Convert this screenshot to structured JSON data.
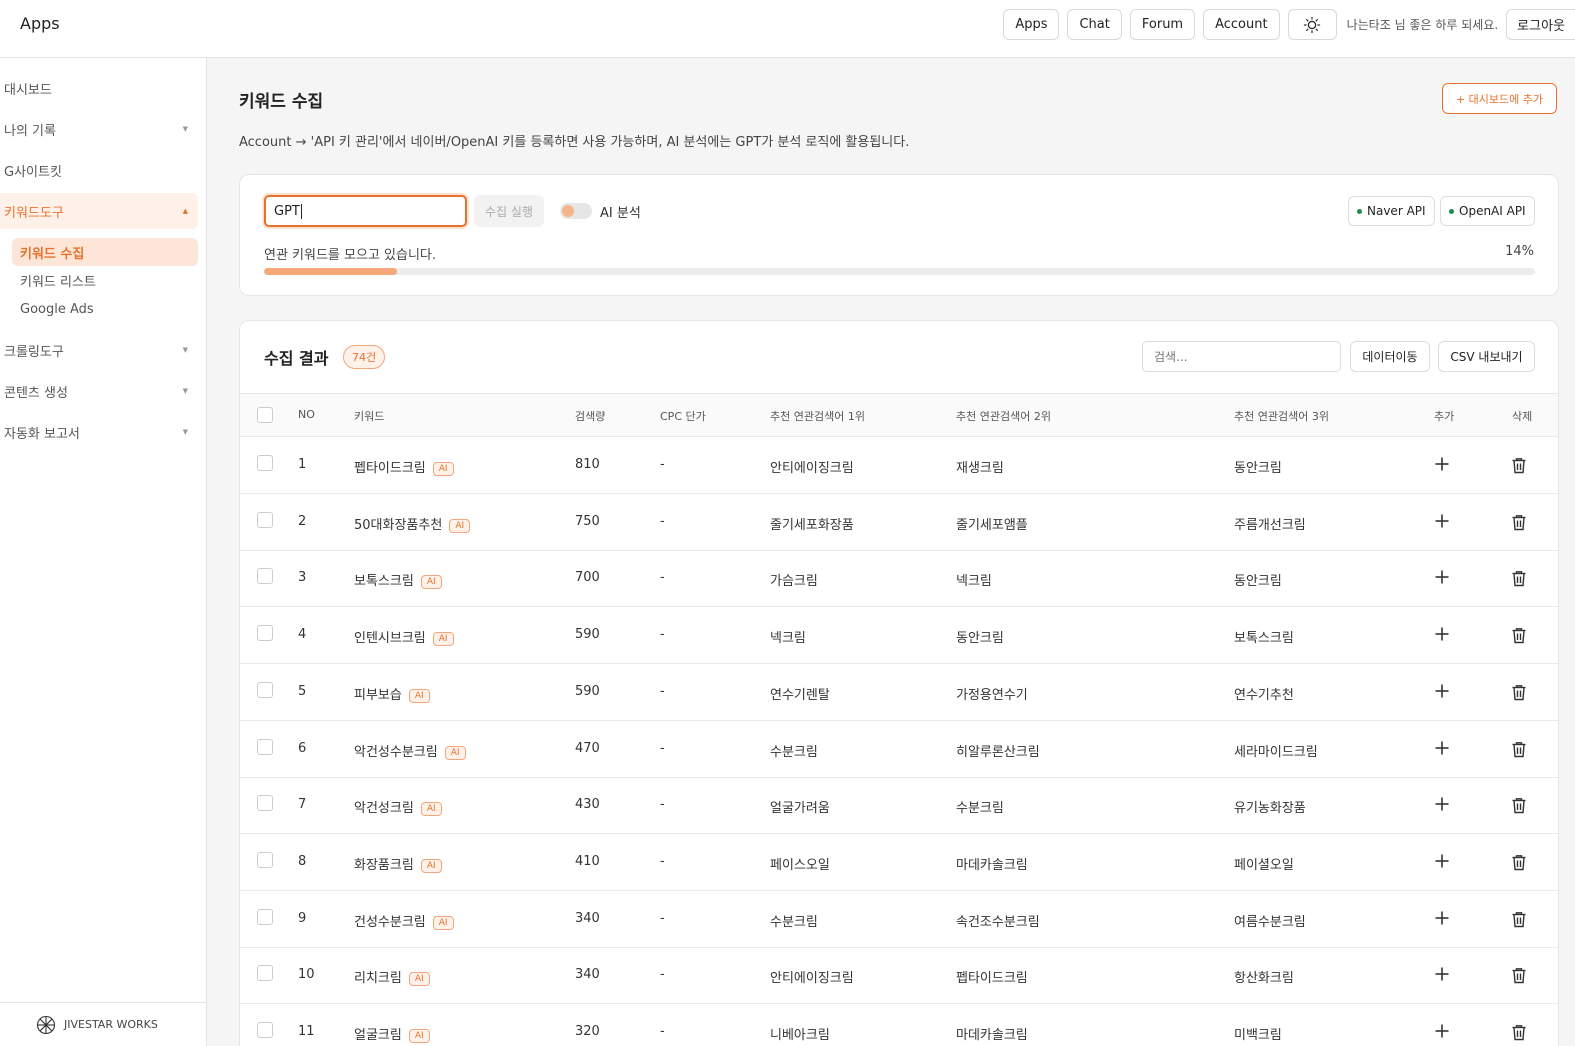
{
  "header": {
    "brand": "Apps",
    "nav": [
      "Apps",
      "Chat",
      "Forum",
      "Account"
    ],
    "theme_icon": "sun-icon",
    "greeting": "나는타조 님 좋은 하루 되세요.",
    "logout": "로그아웃"
  },
  "sidebar": {
    "items": [
      {
        "label": "대시보드",
        "caret": false
      },
      {
        "label": "나의 기록",
        "caret": true
      },
      {
        "label": "G사이트킷",
        "caret": false
      },
      {
        "label": "키워드도구",
        "caret": true,
        "active": true
      },
      {
        "label": "크롤링도구",
        "caret": true
      },
      {
        "label": "콘텐츠 생성",
        "caret": true
      },
      {
        "label": "자동화 보고서",
        "caret": true
      }
    ],
    "sub_items": [
      {
        "label": "키워드 수집",
        "active": true
      },
      {
        "label": "키워드 리스트"
      },
      {
        "label": "Google Ads"
      }
    ],
    "footer": "JIVESTAR WORKS"
  },
  "main": {
    "title": "키워드 수집",
    "add_dashboard": "+ 대시보드에 추가",
    "description": "Account → 'API 키 관리'에서 네이버/OpenAI 키를 등록하면 사용 가능하며, AI 분석에는 GPT가 분석 로직에 활용됩니다."
  },
  "collector": {
    "keyword_value": "GPT",
    "run_label": "수집 실행",
    "ai_toggle_label": "AI 분석",
    "ai_toggle_on": false,
    "apis": [
      "Naver API",
      "OpenAI API"
    ],
    "status_color": "#1e8a4c",
    "progress_text": "연관 키워드를 모으고 있습니다.",
    "progress_pct_label": "14%",
    "progress_value": 0.105
  },
  "results": {
    "title": "수집 결과",
    "count": "74건",
    "search_placeholder": "검색...",
    "move_label": "데이터이동",
    "csv_label": "CSV 내보내기",
    "columns": {
      "no": "NO",
      "keyword": "키워드",
      "volume": "검색량",
      "cpc": "CPC 단가",
      "rel1": "추천 연관검색어 1위",
      "rel2": "추천 연관검색어 2위",
      "rel3": "추천 연관검색어 3위",
      "add": "추가",
      "delete": "삭제"
    },
    "ai_badge": "AI",
    "rows": [
      {
        "no": "1",
        "keyword": "펩타이드크림",
        "volume": "810",
        "cpc": "-",
        "rel1": "안티에이징크림",
        "rel2": "재생크림",
        "rel3": "동안크림"
      },
      {
        "no": "2",
        "keyword": "50대화장품추천",
        "volume": "750",
        "cpc": "-",
        "rel1": "줄기세포화장품",
        "rel2": "줄기세포앰플",
        "rel3": "주름개선크림"
      },
      {
        "no": "3",
        "keyword": "보톡스크림",
        "volume": "700",
        "cpc": "-",
        "rel1": "가슴크림",
        "rel2": "넥크림",
        "rel3": "동안크림"
      },
      {
        "no": "4",
        "keyword": "인텐시브크림",
        "volume": "590",
        "cpc": "-",
        "rel1": "넥크림",
        "rel2": "동안크림",
        "rel3": "보톡스크림"
      },
      {
        "no": "5",
        "keyword": "피부보습",
        "volume": "590",
        "cpc": "-",
        "rel1": "연수기렌탈",
        "rel2": "가정용연수기",
        "rel3": "연수기추천"
      },
      {
        "no": "6",
        "keyword": "악건성수분크림",
        "volume": "470",
        "cpc": "-",
        "rel1": "수분크림",
        "rel2": "히알루론산크림",
        "rel3": "세라마이드크림"
      },
      {
        "no": "7",
        "keyword": "악건성크림",
        "volume": "430",
        "cpc": "-",
        "rel1": "얼굴가려움",
        "rel2": "수분크림",
        "rel3": "유기농화장품"
      },
      {
        "no": "8",
        "keyword": "화장품크림",
        "volume": "410",
        "cpc": "-",
        "rel1": "페이스오일",
        "rel2": "마데카솔크림",
        "rel3": "페이셜오일"
      },
      {
        "no": "9",
        "keyword": "건성수분크림",
        "volume": "340",
        "cpc": "-",
        "rel1": "수분크림",
        "rel2": "속건조수분크림",
        "rel3": "여름수분크림"
      },
      {
        "no": "10",
        "keyword": "리치크림",
        "volume": "340",
        "cpc": "-",
        "rel1": "안티에이징크림",
        "rel2": "펩타이드크림",
        "rel3": "항산화크림"
      },
      {
        "no": "11",
        "keyword": "얼굴크림",
        "volume": "320",
        "cpc": "-",
        "rel1": "니베아크림",
        "rel2": "마데카솔크림",
        "rel3": "미백크림"
      }
    ]
  },
  "colors": {
    "accent": "#e8722d",
    "accent_soft": "#fdf1ea",
    "progress": "#f6a878"
  }
}
